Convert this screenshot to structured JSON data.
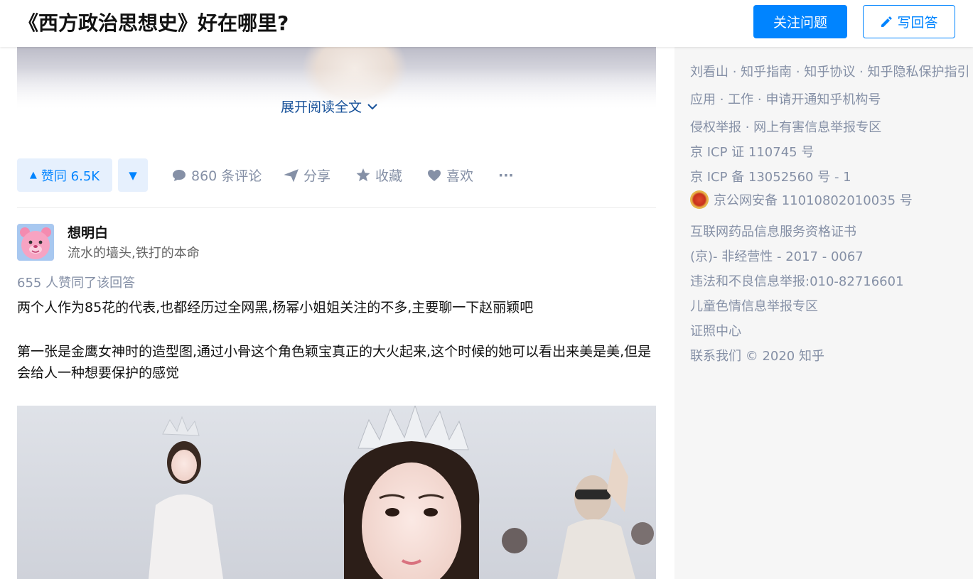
{
  "header": {
    "question_title": "《西方政治思想史》好在哪里?",
    "follow_button": "关注问题",
    "write_answer_button": "写回答"
  },
  "previous_answer": {
    "expand_label": "展开阅读全文"
  },
  "actions": {
    "upvote_label": "赞同 6.5K",
    "comments_label": "860 条评论",
    "share_label": "分享",
    "favorite_label": "收藏",
    "like_label": "喜欢",
    "more_label": "···"
  },
  "answer": {
    "author_name": "想明白",
    "author_bio": "流水的墙头,铁打的本命",
    "vote_info": "655 人赞同了该回答",
    "paragraph_1": "两个人作为85花的代表,也都经历过全网黑,杨幂小姐姐关注的不多,主要聊一下赵丽颖吧",
    "paragraph_2": "第一张是金鹰女神时的造型图,通过小骨这个角色颖宝真正的大火起来,这个时候的她可以看出来美是美,但是会给人一种想要保护的感觉"
  },
  "sidebar": {
    "links_1": "刘看山 · 知乎指南 · 知乎协议 · 知乎隐私保护指引",
    "links_2": "应用 · 工作 · 申请开通知乎机构号",
    "links_3": "侵权举报 · 网上有害信息举报专区",
    "icp_1": "京 ICP 证 110745 号",
    "icp_2": "京 ICP 备 13052560 号 - 1",
    "police": "京公网安备 11010802010035 号",
    "drug_1": "互联网药品信息服务资格证书",
    "drug_2": "(京)- 非经营性 - 2017 - 0067",
    "report_phone": "违法和不良信息举报:010-82716601",
    "child_report": "儿童色情信息举报专区",
    "license_center": "证照中心",
    "contact": "联系我们 © 2020 知乎"
  },
  "colors": {
    "brand_blue": "#0084ff",
    "link_blue": "#175199",
    "meta_gray": "#8590a6"
  }
}
